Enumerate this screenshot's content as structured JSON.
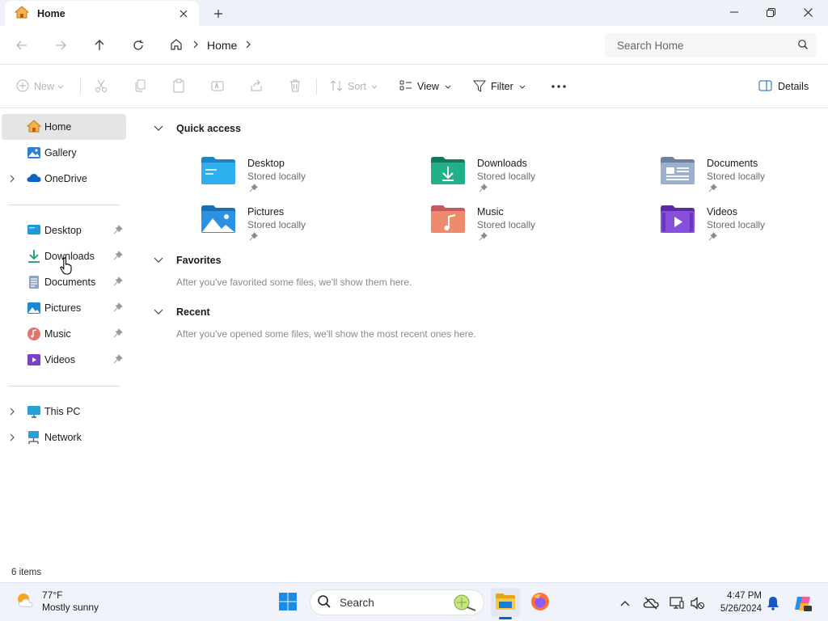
{
  "tab": {
    "title": "Home"
  },
  "address": {
    "crumbs": [
      "Home"
    ]
  },
  "search": {
    "placeholder": "Search Home"
  },
  "commands": {
    "new": "New",
    "sort": "Sort",
    "view": "View",
    "filter": "Filter",
    "details": "Details"
  },
  "sidebar": {
    "top": [
      {
        "label": "Home",
        "icon": "home-icon"
      },
      {
        "label": "Gallery",
        "icon": "gallery-icon"
      },
      {
        "label": "OneDrive",
        "icon": "onedrive-icon"
      }
    ],
    "pinned": [
      {
        "label": "Desktop",
        "icon": "desktop-folder-icon"
      },
      {
        "label": "Downloads",
        "icon": "downloads-icon"
      },
      {
        "label": "Documents",
        "icon": "documents-icon"
      },
      {
        "label": "Pictures",
        "icon": "pictures-icon"
      },
      {
        "label": "Music",
        "icon": "music-icon"
      },
      {
        "label": "Videos",
        "icon": "videos-icon"
      }
    ],
    "bottom": [
      {
        "label": "This PC",
        "icon": "pc-icon"
      },
      {
        "label": "Network",
        "icon": "network-icon"
      }
    ]
  },
  "sections": {
    "quick_access": "Quick access",
    "favorites": "Favorites",
    "favorites_empty": "After you've favorited some files, we'll show them here.",
    "recent": "Recent",
    "recent_empty": "After you've opened some files, we'll show the most recent ones here."
  },
  "quick_access": [
    {
      "name": "Desktop",
      "sub": "Stored locally"
    },
    {
      "name": "Downloads",
      "sub": "Stored locally"
    },
    {
      "name": "Documents",
      "sub": "Stored locally"
    },
    {
      "name": "Pictures",
      "sub": "Stored locally"
    },
    {
      "name": "Music",
      "sub": "Stored locally"
    },
    {
      "name": "Videos",
      "sub": "Stored locally"
    }
  ],
  "status": {
    "items": "6 items"
  },
  "taskbar": {
    "weather_temp": "77°F",
    "weather_desc": "Mostly sunny",
    "search_label": "Search",
    "time": "4:47 PM",
    "date": "5/26/2024"
  },
  "colors": {
    "accent": "#0067c0",
    "selected": "#e5e5e5",
    "folder_blue": "#1f9ae0"
  }
}
